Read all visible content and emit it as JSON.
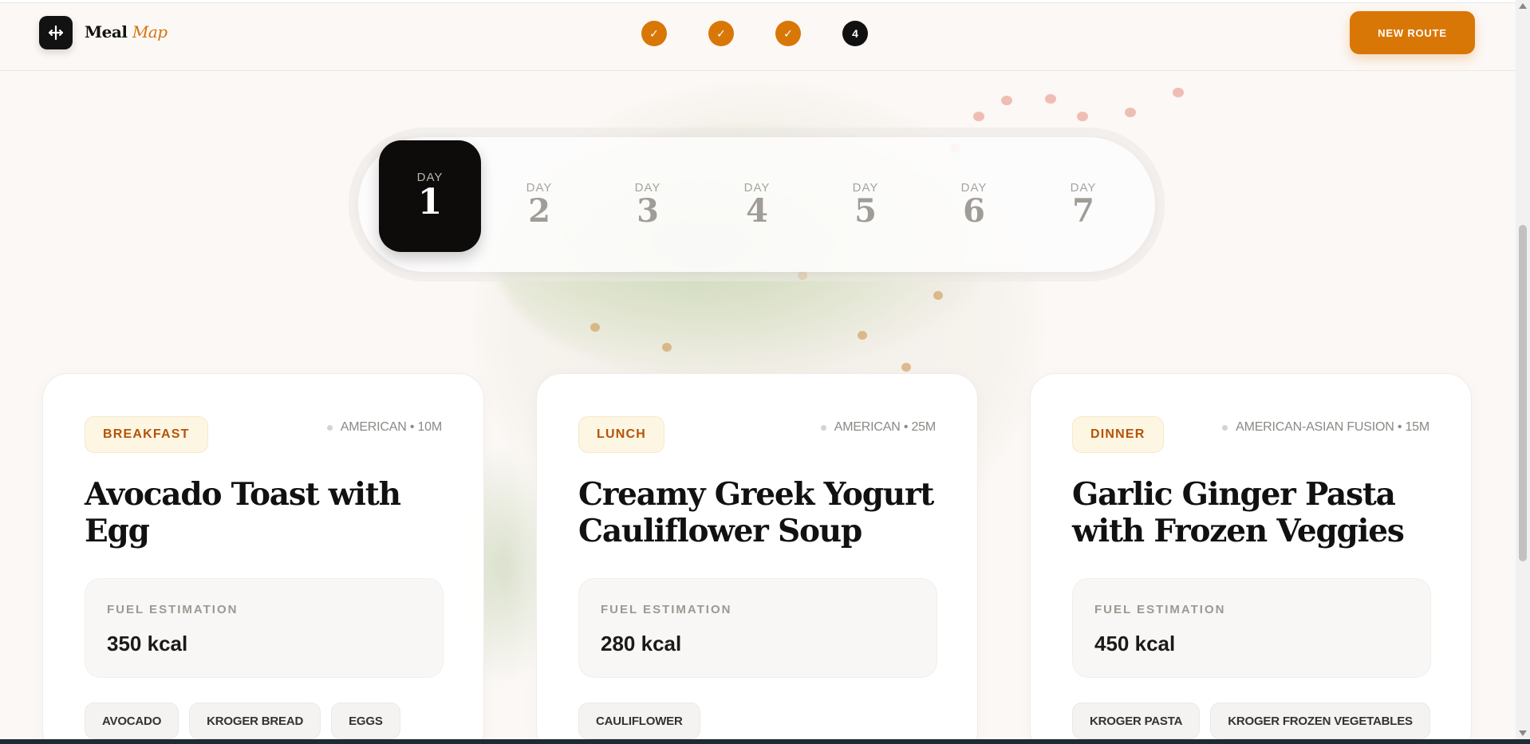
{
  "header": {
    "brand_main": "Meal",
    "brand_accent": "Map",
    "steps": [
      {
        "label": "✓",
        "state": "done"
      },
      {
        "label": "✓",
        "state": "done"
      },
      {
        "label": "✓",
        "state": "done"
      },
      {
        "label": "4",
        "state": "current"
      }
    ],
    "new_route_label": "NEW ROUTE"
  },
  "days": {
    "label": "DAY",
    "items": [
      "1",
      "2",
      "3",
      "4",
      "5",
      "6",
      "7"
    ],
    "active": "1"
  },
  "meals": [
    {
      "type": "BREAKFAST",
      "cuisine": "AMERICAN • 10M",
      "title": "Avocado Toast with Egg",
      "fuel_label": "FUEL ESTIMATION",
      "fuel_value": "350 kcal",
      "ingredients": [
        "AVOCADO",
        "KROGER BREAD",
        "EGGS"
      ]
    },
    {
      "type": "LUNCH",
      "cuisine": "AMERICAN • 25M",
      "title": "Creamy Greek Yogurt Cauliflower Soup",
      "fuel_label": "FUEL ESTIMATION",
      "fuel_value": "280 kcal",
      "ingredients": [
        "CAULIFLOWER"
      ]
    },
    {
      "type": "DINNER",
      "cuisine": "AMERICAN-ASIAN FUSION • 15M",
      "title": "Garlic Ginger Pasta with Frozen Veggies",
      "fuel_label": "FUEL ESTIMATION",
      "fuel_value": "450 kcal",
      "ingredients": [
        "KROGER PASTA",
        "KROGER FROZEN VEGETABLES"
      ]
    }
  ],
  "colors": {
    "accent": "#d97706",
    "dark": "#111111",
    "background": "#fbf8f5"
  }
}
